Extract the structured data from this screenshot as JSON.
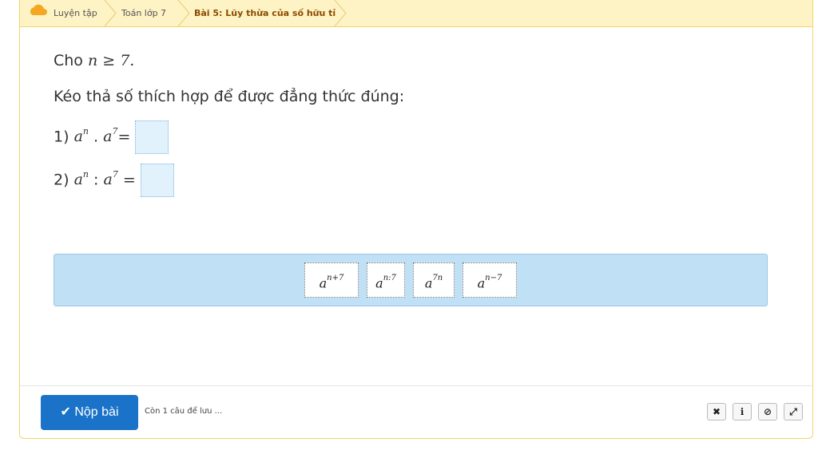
{
  "breadcrumb": {
    "items": [
      {
        "label": "Luyện tập",
        "icon": "cloud-icon"
      },
      {
        "label": "Toán lớp 7"
      },
      {
        "label": "Bài 5: Lũy thừa của số hữu tỉ"
      }
    ]
  },
  "question": {
    "intro": "Cho",
    "condition": "n ≥ 7.",
    "instruction": "Kéo thả số thích hợp để được đẳng thức đúng:",
    "items": [
      {
        "number": "1)",
        "expr_base": "a",
        "expr_exp": "n",
        "op": ".",
        "rhs_base": "a",
        "rhs_exp": "7",
        "eq": "="
      },
      {
        "number": "2)",
        "expr_base": "a",
        "expr_exp": "n",
        "op": ":",
        "rhs_base": "a",
        "rhs_exp": "7",
        "eq": "="
      }
    ]
  },
  "choices": [
    {
      "base": "a",
      "exp": "n+7"
    },
    {
      "base": "a",
      "exp": "n:7"
    },
    {
      "base": "a",
      "exp": "7n"
    },
    {
      "base": "a",
      "exp": "n−7"
    }
  ],
  "footer": {
    "submit_label": "✔ Nộp bài",
    "status_text": "Còn 1 câu để lưu ...",
    "tools": [
      {
        "icon": "close-icon",
        "glyph": "✖"
      },
      {
        "icon": "info-icon",
        "glyph": "ℹ"
      },
      {
        "icon": "ban-icon",
        "glyph": "⊘"
      },
      {
        "icon": "fullscreen-icon",
        "glyph": "⤢"
      }
    ]
  },
  "colors": {
    "breadcrumb_bg": "#fdf3c4",
    "accent": "#1a73c8",
    "dropzone_bg": "#e1f2fd",
    "bank_bg": "#bfe0f5"
  }
}
